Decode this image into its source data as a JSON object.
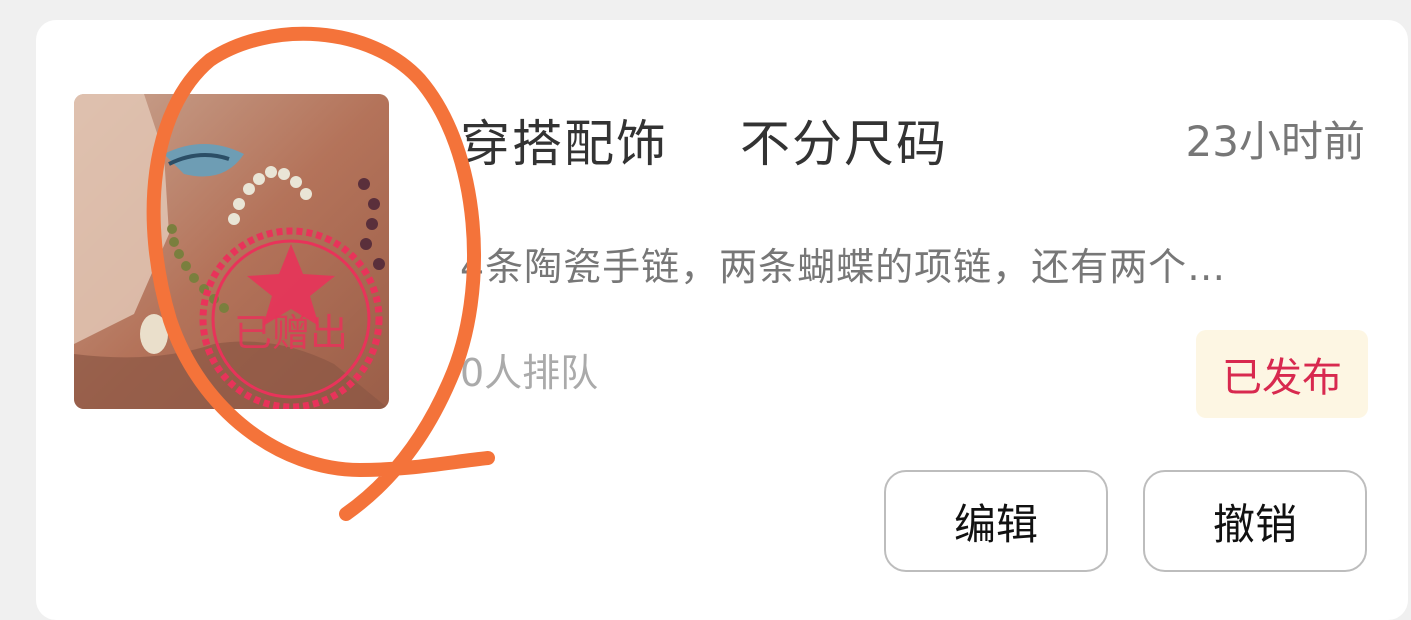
{
  "item": {
    "category": "穿搭配饰",
    "size": "不分尺码",
    "time_ago": "23小时前",
    "description": "4条陶瓷手链，两条蝴蝶的项链，还有两个…",
    "queue_text": "0人排队",
    "status": "已发布",
    "stamp_text": "已赠出"
  },
  "actions": {
    "edit_label": "编辑",
    "revoke_label": "撤销"
  },
  "colors": {
    "status_text": "#d8294f",
    "status_bg": "#fdf6e3",
    "stamp": "#e8335a",
    "annotation": "#f4733a"
  }
}
